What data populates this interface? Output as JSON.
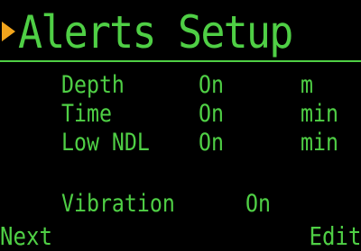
{
  "screen": {
    "title": "Alerts Setup",
    "cursor_icon": "triangle-right-cursor",
    "colors": {
      "text": "#4fcf45",
      "cursor": "#f2a51c",
      "background": "#000000"
    }
  },
  "alerts": [
    {
      "name": "Depth",
      "state": "On",
      "unit": "m"
    },
    {
      "name": "Time",
      "state": "On",
      "unit": "min"
    },
    {
      "name": "Low NDL",
      "state": "On",
      "unit": "min"
    }
  ],
  "vibration": {
    "label": "Vibration",
    "state": "On"
  },
  "softkeys": {
    "left": "Next",
    "right": "Edit"
  }
}
